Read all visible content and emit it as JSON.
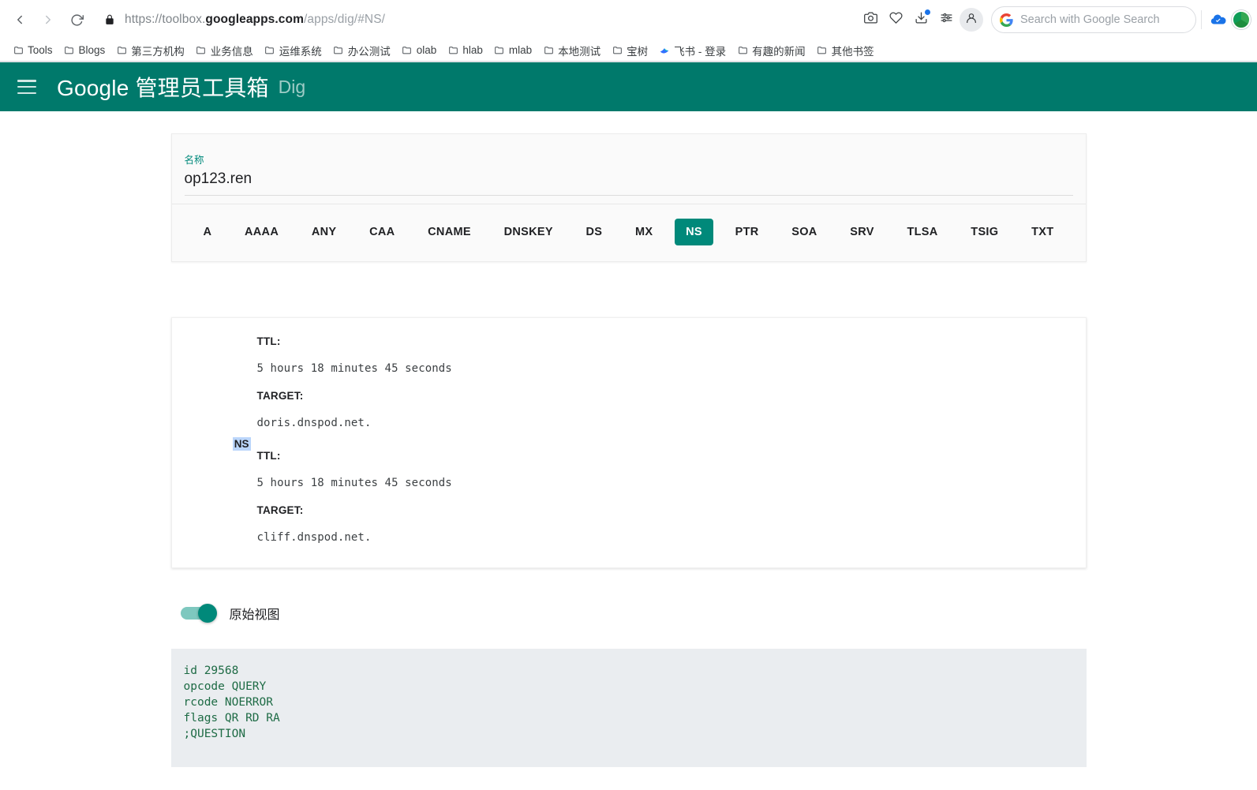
{
  "browser": {
    "back_icon": "back-arrow-icon",
    "forward_icon": "forward-arrow-icon",
    "reload_icon": "reload-icon",
    "lock_icon": "lock-icon",
    "url_scheme": "https://",
    "url_subdomain": "toolbox.",
    "url_domain": "googleapps.com",
    "url_path": "/apps/dig/#NS/",
    "toolbar_icons": [
      {
        "name": "screenshot-camera-icon"
      },
      {
        "name": "favorites-heart-icon"
      },
      {
        "name": "downloads-icon"
      },
      {
        "name": "settings-sliders-icon"
      },
      {
        "name": "profile-person-icon"
      }
    ],
    "search_placeholder": "Search with Google Search",
    "cloud_icon": "cloud-check-icon",
    "avatar": "user-avatar"
  },
  "bookmarks": [
    {
      "label": "Tools",
      "icon": "folder-icon"
    },
    {
      "label": "Blogs",
      "icon": "folder-icon"
    },
    {
      "label": "第三方机构",
      "icon": "folder-icon"
    },
    {
      "label": "业务信息",
      "icon": "folder-icon"
    },
    {
      "label": "运维系统",
      "icon": "folder-icon"
    },
    {
      "label": "办公测试",
      "icon": "folder-icon"
    },
    {
      "label": "olab",
      "icon": "folder-icon"
    },
    {
      "label": "hlab",
      "icon": "folder-icon"
    },
    {
      "label": "mlab",
      "icon": "folder-icon"
    },
    {
      "label": "本地测试",
      "icon": "folder-icon"
    },
    {
      "label": "宝树",
      "icon": "folder-icon"
    },
    {
      "label": "飞书 - 登录",
      "icon": "feishu-icon"
    },
    {
      "label": "有趣的新闻",
      "icon": "folder-icon"
    },
    {
      "label": "其他书签",
      "icon": "folder-icon"
    }
  ],
  "app": {
    "menu_icon": "hamburger-menu-icon",
    "title": "Google 管理员工具箱",
    "subtitle": "Dig",
    "header_color": "#00796b"
  },
  "search": {
    "field_label": "名称",
    "field_value": "op123.ren",
    "accent_color": "#00897a"
  },
  "record_types": [
    {
      "label": "A",
      "active": false
    },
    {
      "label": "AAAA",
      "active": false
    },
    {
      "label": "ANY",
      "active": false
    },
    {
      "label": "CAA",
      "active": false
    },
    {
      "label": "CNAME",
      "active": false
    },
    {
      "label": "DNSKEY",
      "active": false
    },
    {
      "label": "DS",
      "active": false
    },
    {
      "label": "MX",
      "active": false
    },
    {
      "label": "NS",
      "active": true
    },
    {
      "label": "PTR",
      "active": false
    },
    {
      "label": "SOA",
      "active": false
    },
    {
      "label": "SRV",
      "active": false
    },
    {
      "label": "TLSA",
      "active": false
    },
    {
      "label": "TSIG",
      "active": false
    },
    {
      "label": "TXT",
      "active": false
    }
  ],
  "results": {
    "record_type_badge": "NS",
    "records": [
      {
        "ttl_key": "TTL:",
        "ttl_value": "5 hours 18 minutes 45 seconds",
        "target_key": "TARGET:",
        "target_value": "doris.dnspod.net."
      },
      {
        "ttl_key": "TTL:",
        "ttl_value": "5 hours 18 minutes 45 seconds",
        "target_key": "TARGET:",
        "target_value": "cliff.dnspod.net."
      }
    ]
  },
  "raw_view": {
    "toggle_on": true,
    "toggle_label": "原始视图",
    "output": "id 29568\nopcode QUERY\nrcode NOERROR\nflags QR RD RA\n;QUESTION"
  }
}
